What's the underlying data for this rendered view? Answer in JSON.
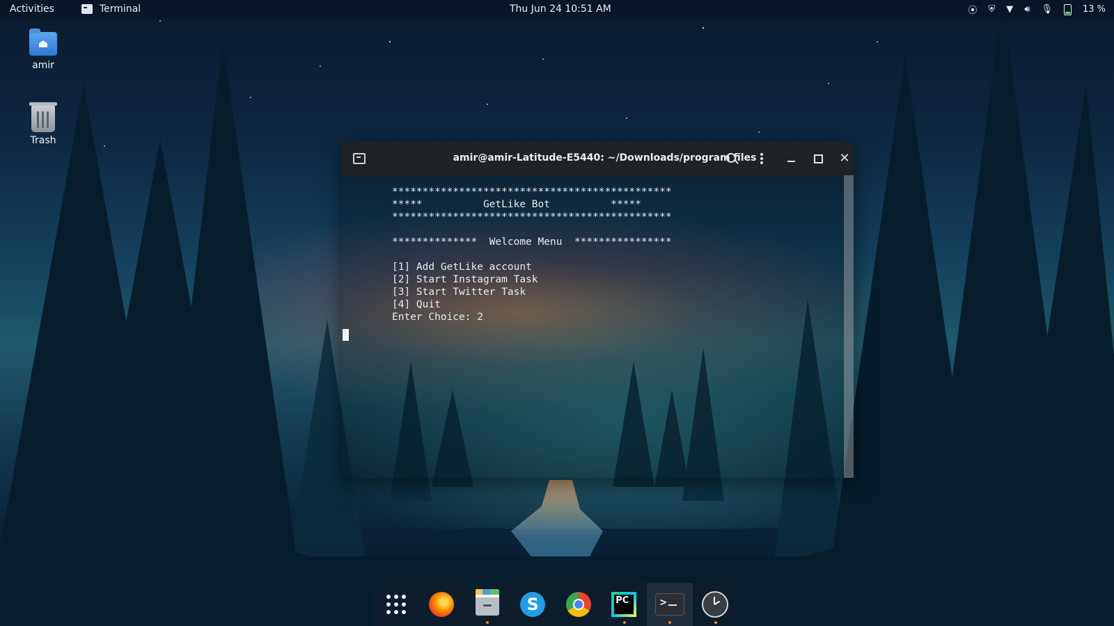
{
  "topbar": {
    "activities": "Activities",
    "app_name": "Terminal",
    "clock": "Thu Jun 24  10:51 AM",
    "battery": "13 %"
  },
  "desktop": {
    "icons": [
      {
        "label": "amir",
        "icon": "home-folder-icon"
      },
      {
        "label": "Trash",
        "icon": "trash-icon"
      }
    ]
  },
  "terminal": {
    "title": "amir@amir-Latitude-E5440: ~/Downloads/program files",
    "output": "**********************************************\n*****          GetLike Bot          *****\n**********************************************\n\n**************  Welcome Menu  ****************\n\n[1] Add GetLike account\n[2] Start Instagram Task\n[3] Start Twitter Task\n[4] Quit\nEnter Choice: 2"
  },
  "dock": {
    "items": [
      "app-grid-icon",
      "firefox-icon",
      "files-icon",
      "skype-icon",
      "chrome-icon",
      "pycharm-icon",
      "terminal-icon",
      "clock-icon"
    ]
  }
}
